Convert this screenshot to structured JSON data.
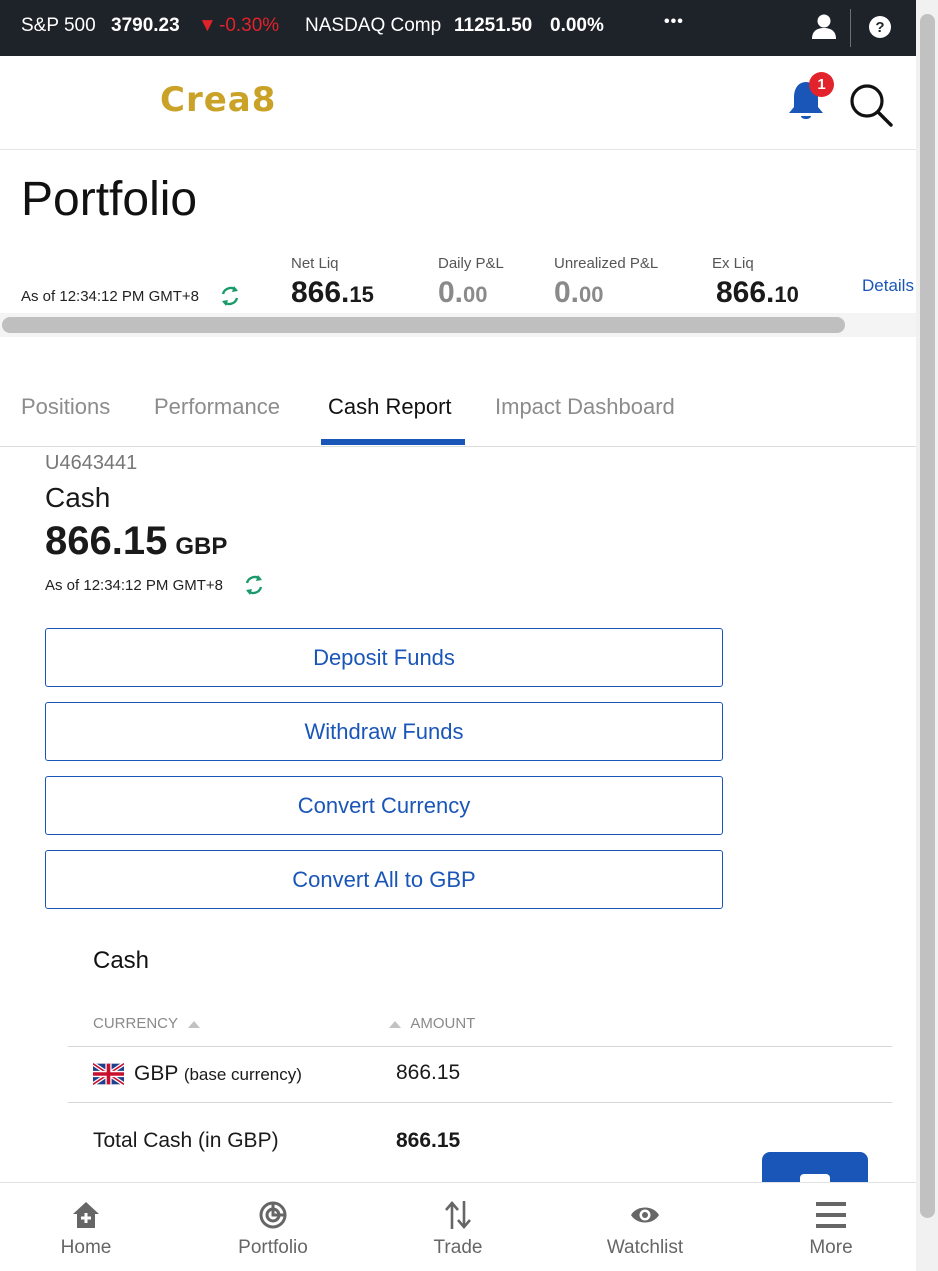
{
  "ticker": {
    "index1_name": "S&P 500",
    "index1_value": "3790.23",
    "index1_arrow": "▼",
    "index1_change": "-0.30%",
    "index2_name": "NASDAQ Comp",
    "index2_value": "11251.50",
    "index2_change": "0.00%",
    "more_label": "•••",
    "down_color": "#e0232b"
  },
  "header": {
    "logo": "Crea8",
    "notification_count": "1",
    "icons": [
      "bell-icon",
      "search-icon",
      "user-icon",
      "help-icon"
    ]
  },
  "portfolio": {
    "title": "Portfolio",
    "as_of": "As of 12:34:12 PM GMT+8",
    "metrics": [
      {
        "label": "Net Liq",
        "int": "866.",
        "dec": "15"
      },
      {
        "label": "Daily P&L",
        "int": "0.",
        "dec": "00"
      },
      {
        "label": "Unrealized P&L",
        "int": "0.",
        "dec": "00"
      },
      {
        "label": "Ex Liq",
        "int": "866.",
        "dec": "10"
      }
    ],
    "details_link": "Details"
  },
  "tabs": [
    {
      "label": "Positions",
      "active": false
    },
    {
      "label": "Performance",
      "active": false
    },
    {
      "label": "Cash Report",
      "active": true
    },
    {
      "label": "Impact Dashboard",
      "active": false
    }
  ],
  "account": {
    "id": "U4643441",
    "heading": "Cash",
    "amount": "866.15",
    "currency": "GBP",
    "as_of": "As of 12:34:12 PM GMT+8"
  },
  "actions": {
    "deposit": "Deposit Funds",
    "withdraw": "Withdraw Funds",
    "convert": "Convert Currency",
    "convert_all": "Convert All to GBP"
  },
  "cash_table": {
    "title": "Cash",
    "col_currency": "CURRENCY",
    "col_amount": "AMOUNT",
    "rows": [
      {
        "currency": "GBP",
        "note": "(base currency)",
        "amount": "866.15"
      }
    ],
    "total_label": "Total Cash (in GBP)",
    "total_amount": "866.15"
  },
  "bottom_nav": [
    {
      "label": "Home",
      "icon": "home-icon"
    },
    {
      "label": "Portfolio",
      "icon": "portfolio-icon"
    },
    {
      "label": "Trade",
      "icon": "trade-icon"
    },
    {
      "label": "Watchlist",
      "icon": "watchlist-icon"
    },
    {
      "label": "More",
      "icon": "menu-icon"
    }
  ],
  "colors": {
    "brand_gold": "#c9a227",
    "accent_blue": "#1a56b8",
    "refresh_green": "#1a9a6a",
    "badge_red": "#e3232b"
  }
}
